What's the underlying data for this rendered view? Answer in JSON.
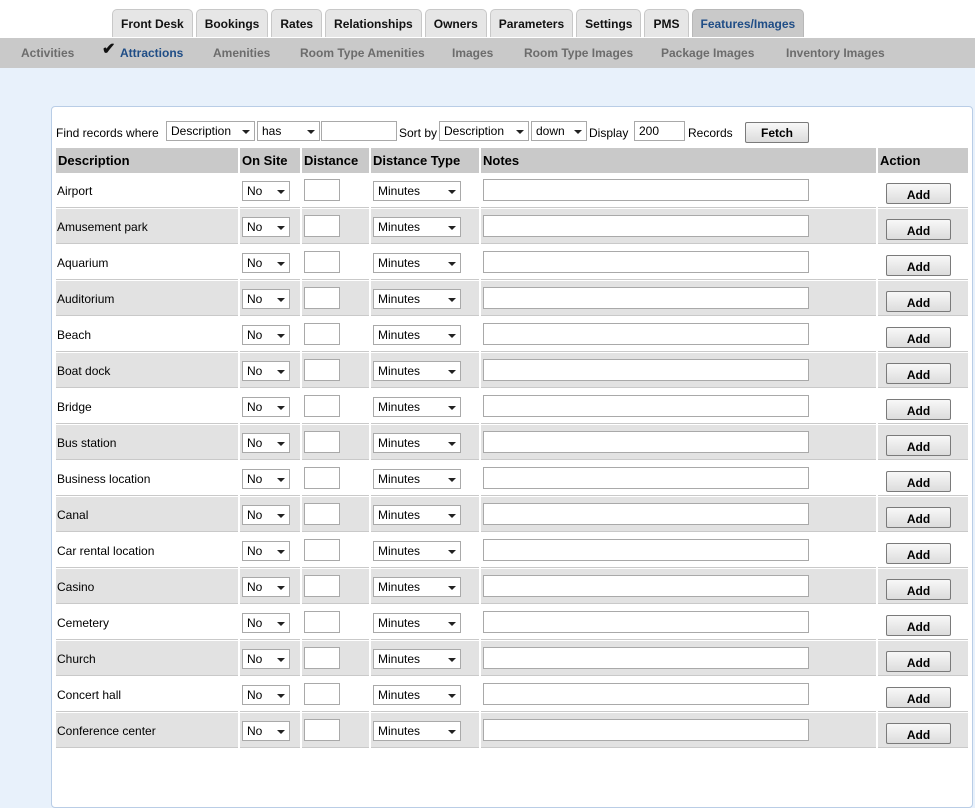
{
  "tabs": [
    {
      "label": "Front Desk",
      "active": false
    },
    {
      "label": "Bookings",
      "active": false
    },
    {
      "label": "Rates",
      "active": false
    },
    {
      "label": "Relationships",
      "active": false
    },
    {
      "label": "Owners",
      "active": false
    },
    {
      "label": "Parameters",
      "active": false
    },
    {
      "label": "Settings",
      "active": false
    },
    {
      "label": "PMS",
      "active": false
    },
    {
      "label": "Features/Images",
      "active": true
    }
  ],
  "subnav": [
    {
      "label": "Activities",
      "active": false
    },
    {
      "label": "Attractions",
      "active": true
    },
    {
      "label": "Amenities",
      "active": false
    },
    {
      "label": "Room Type Amenities",
      "active": false
    },
    {
      "label": "Images",
      "active": false
    },
    {
      "label": "Room Type Images",
      "active": false
    },
    {
      "label": "Package Images",
      "active": false
    },
    {
      "label": "Inventory Images",
      "active": false
    }
  ],
  "check_mark": "✔",
  "filter": {
    "find_label": "Find records where",
    "field_value": "Description",
    "operator_value": "has",
    "search_value": "",
    "sort_label": "Sort by",
    "sort_value": "Description",
    "direction_value": "down",
    "display_label": "Display",
    "display_value": "200",
    "records_label": "Records",
    "fetch_label": "Fetch"
  },
  "columns": {
    "description": "Description",
    "on_site": "On Site",
    "distance": "Distance",
    "distance_type": "Distance Type",
    "notes": "Notes",
    "action": "Action"
  },
  "row_defaults": {
    "on_site": "No",
    "distance": "",
    "distance_type": "Minutes",
    "notes": "",
    "action": "Add"
  },
  "rows": [
    "Airport",
    "Amusement park",
    "Aquarium",
    "Auditorium",
    "Beach",
    "Boat dock",
    "Bridge",
    "Bus station",
    "Business location",
    "Canal",
    "Car rental location",
    "Casino",
    "Cemetery",
    "Church",
    "Concert hall",
    "Conference center"
  ]
}
